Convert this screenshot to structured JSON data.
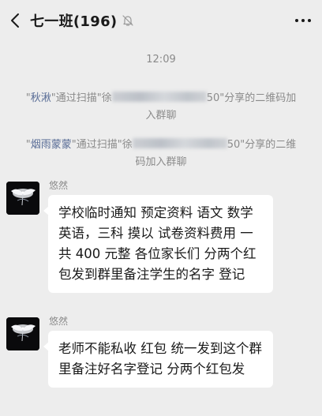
{
  "header": {
    "title": "七一班(196)",
    "back_icon": "chevron-left-icon",
    "mute_icon": "bell-off-icon",
    "more_icon": "more-dots-icon"
  },
  "timestamp": "12:09",
  "system_messages": [
    {
      "quote_open": "\"",
      "name": "秋湫",
      "mid": "\"通过扫描\"徐",
      "tail": "50\"分享的二维码加入群聊"
    },
    {
      "quote_open": "\"",
      "name": "烟雨蒙蒙",
      "mid": "\"通过扫描\"徐",
      "tail": "50\"分享的二维码加入群聊"
    }
  ],
  "messages": [
    {
      "sender": "悠然",
      "text": "学校临时通知  预定资料 语文  数学  英语，三科 摸以 试卷资料费用 一共 400 元整   各位家长们 分两个红包发到群里备注学生的名字   登记"
    },
    {
      "sender": "悠然",
      "text": "老师不能私收 红包  统一发到这个群里备注好名字登记 分两个红包发"
    }
  ],
  "colors": {
    "background": "#ededed",
    "bubble": "#ffffff",
    "link_name": "#576b95",
    "meta_text": "#8a8a8a"
  }
}
